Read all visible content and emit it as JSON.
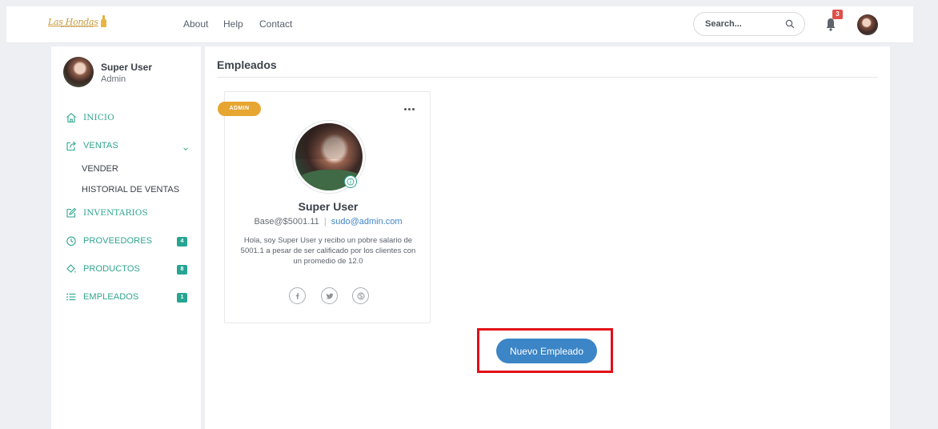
{
  "navbar": {
    "logo_text": "Las Hondas",
    "links": [
      "About",
      "Help",
      "Contact"
    ],
    "search_placeholder": "Search...",
    "notification_count": "3"
  },
  "sidebar": {
    "user": {
      "name": "Super User",
      "role": "Admin"
    },
    "items": [
      {
        "label": "INICIO",
        "icon": "home-icon"
      },
      {
        "label": "VENTAS",
        "icon": "share-icon",
        "expanded": true,
        "children": [
          "VENDER",
          "HISTORIAL DE VENTAS"
        ]
      },
      {
        "label": "INVENTARIOS",
        "icon": "edit-icon"
      },
      {
        "label": "PROVEEDORES",
        "icon": "clock-icon",
        "count": "4"
      },
      {
        "label": "PRODUCTOS",
        "icon": "paint-bucket-icon",
        "count": "8"
      },
      {
        "label": "EMPLEADOS",
        "icon": "list-icon",
        "count": "1"
      }
    ]
  },
  "main": {
    "title": "Empleados",
    "card": {
      "badge": "ADMIN",
      "name": "Super User",
      "base": "Base@$5001.11",
      "separator": "|",
      "email": "sudo@admin.com",
      "bio": "Hola, soy Super User y recibo un pobre salario de 5001.1 a pesar de ser calificado por los clientes con un promedio de 12.0",
      "socials": [
        "facebook-icon",
        "twitter-icon",
        "skype-icon"
      ]
    },
    "new_button": "Nuevo Empleado"
  },
  "colors": {
    "accent": "#2fa68f",
    "button_blue": "#3c85c6",
    "badge_orange": "#e6a631",
    "alert_red": "#e0504a",
    "highlight_red": "#e10f17"
  }
}
